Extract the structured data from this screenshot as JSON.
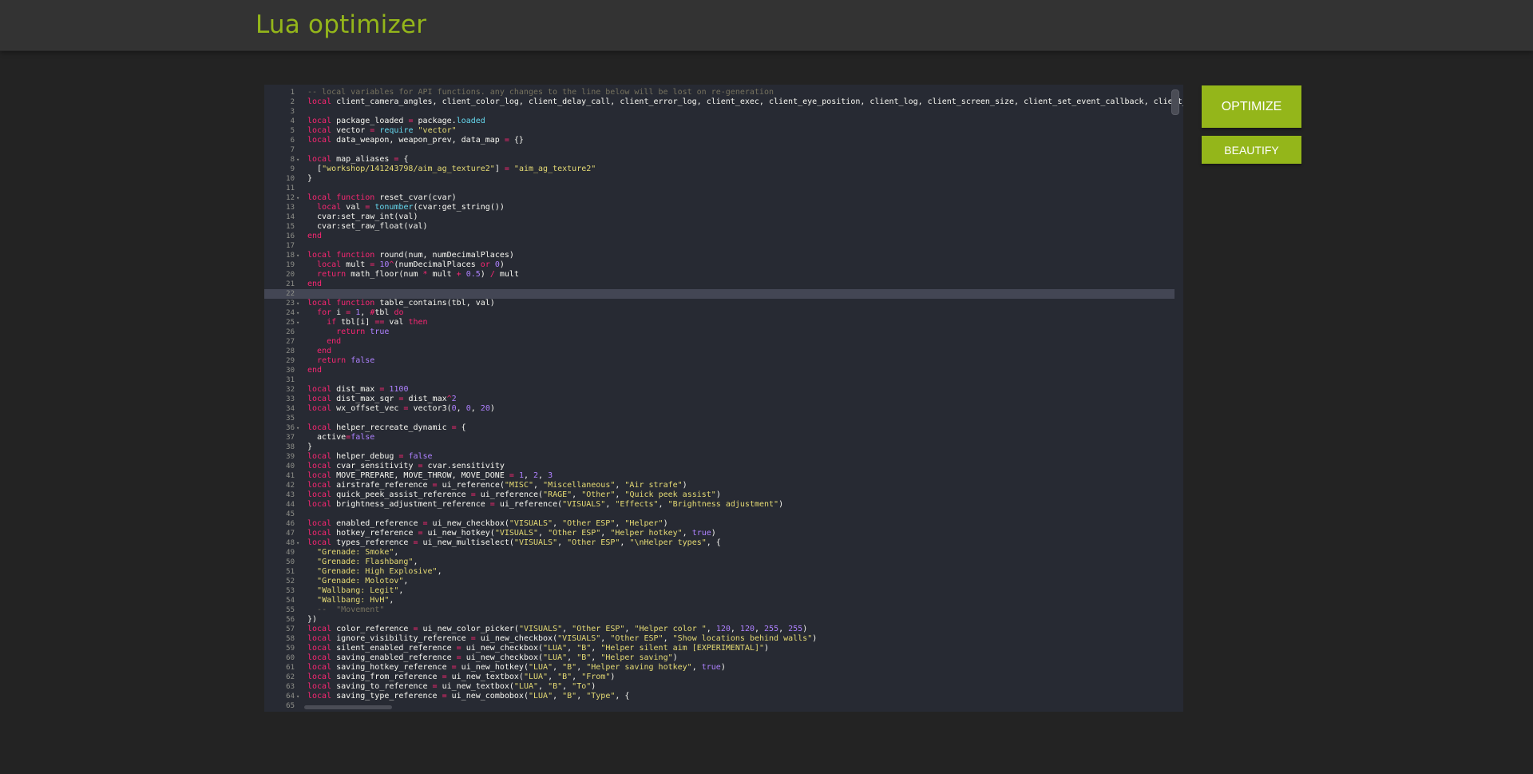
{
  "header": {
    "title": "Lua optimizer"
  },
  "buttons": {
    "optimize": "OPTIMIZE",
    "beautify": "BEAUTIFY"
  },
  "editor": {
    "active_line": 22,
    "fold_lines": [
      8,
      12,
      18,
      23,
      24,
      25,
      36,
      48,
      64
    ],
    "lines": [
      [
        [
          "c",
          "-- local variables for API functions. any changes to the line below will be lost on re-generation"
        ]
      ],
      [
        [
          "k",
          "local"
        ],
        [
          "t",
          " client_camera_angles, client_color_log, client_delay_call, client_error_log, client_exec, client_eye_position, client_log, client_screen_size, client_set_event_callback, client_userid_to_entindex"
        ]
      ],
      [],
      [
        [
          "k",
          "local"
        ],
        [
          "t",
          " package_loaded "
        ],
        [
          "o",
          "="
        ],
        [
          "t",
          " package."
        ],
        [
          "b",
          "loaded"
        ]
      ],
      [
        [
          "k",
          "local"
        ],
        [
          "t",
          " vector "
        ],
        [
          "o",
          "="
        ],
        [
          "t",
          " "
        ],
        [
          "b",
          "require"
        ],
        [
          "t",
          " "
        ],
        [
          "s",
          "\"vector\""
        ]
      ],
      [
        [
          "k",
          "local"
        ],
        [
          "t",
          " data_weapon, weapon_prev, data_map "
        ],
        [
          "o",
          "="
        ],
        [
          "t",
          " {}"
        ]
      ],
      [],
      [
        [
          "k",
          "local"
        ],
        [
          "t",
          " map_aliases "
        ],
        [
          "o",
          "="
        ],
        [
          "t",
          " {"
        ]
      ],
      [
        [
          "t",
          "  ["
        ],
        [
          "s",
          "\"workshop/141243798/aim_ag_texture2\""
        ],
        [
          "t",
          "] "
        ],
        [
          "o",
          "="
        ],
        [
          "t",
          " "
        ],
        [
          "s",
          "\"aim_ag_texture2\""
        ]
      ],
      [
        [
          "t",
          "}"
        ]
      ],
      [],
      [
        [
          "k",
          "local"
        ],
        [
          "t",
          " "
        ],
        [
          "k",
          "function"
        ],
        [
          "t",
          " reset_cvar(cvar)"
        ]
      ],
      [
        [
          "t",
          "  "
        ],
        [
          "k",
          "local"
        ],
        [
          "t",
          " val "
        ],
        [
          "o",
          "="
        ],
        [
          "t",
          " "
        ],
        [
          "b",
          "tonumber"
        ],
        [
          "t",
          "(cvar:get_string())"
        ]
      ],
      [
        [
          "t",
          "  cvar:set_raw_int(val)"
        ]
      ],
      [
        [
          "t",
          "  cvar:set_raw_float(val)"
        ]
      ],
      [
        [
          "k",
          "end"
        ]
      ],
      [],
      [
        [
          "k",
          "local"
        ],
        [
          "t",
          " "
        ],
        [
          "k",
          "function"
        ],
        [
          "t",
          " round(num, numDecimalPlaces)"
        ]
      ],
      [
        [
          "t",
          "  "
        ],
        [
          "k",
          "local"
        ],
        [
          "t",
          " mult "
        ],
        [
          "o",
          "="
        ],
        [
          "t",
          " "
        ],
        [
          "n",
          "10"
        ],
        [
          "o",
          "^"
        ],
        [
          "t",
          "(numDecimalPlaces "
        ],
        [
          "k",
          "or"
        ],
        [
          "t",
          " "
        ],
        [
          "n",
          "0"
        ],
        [
          "t",
          ")"
        ]
      ],
      [
        [
          "t",
          "  "
        ],
        [
          "k",
          "return"
        ],
        [
          "t",
          " math_floor(num "
        ],
        [
          "o",
          "*"
        ],
        [
          "t",
          " mult "
        ],
        [
          "o",
          "+"
        ],
        [
          "t",
          " "
        ],
        [
          "n",
          "0.5"
        ],
        [
          "t",
          ") "
        ],
        [
          "o",
          "/"
        ],
        [
          "t",
          " mult"
        ]
      ],
      [
        [
          "k",
          "end"
        ]
      ],
      [],
      [
        [
          "k",
          "local"
        ],
        [
          "t",
          " "
        ],
        [
          "k",
          "function"
        ],
        [
          "t",
          " table_contains(tbl, val)"
        ]
      ],
      [
        [
          "t",
          "  "
        ],
        [
          "k",
          "for"
        ],
        [
          "t",
          " i "
        ],
        [
          "o",
          "="
        ],
        [
          "t",
          " "
        ],
        [
          "n",
          "1"
        ],
        [
          "t",
          ", "
        ],
        [
          "o",
          "#"
        ],
        [
          "t",
          "tbl "
        ],
        [
          "k",
          "do"
        ]
      ],
      [
        [
          "t",
          "    "
        ],
        [
          "k",
          "if"
        ],
        [
          "t",
          " tbl[i] "
        ],
        [
          "o",
          "=="
        ],
        [
          "t",
          " val "
        ],
        [
          "k",
          "then"
        ]
      ],
      [
        [
          "t",
          "      "
        ],
        [
          "k",
          "return"
        ],
        [
          "t",
          " "
        ],
        [
          "n",
          "true"
        ]
      ],
      [
        [
          "t",
          "    "
        ],
        [
          "k",
          "end"
        ]
      ],
      [
        [
          "t",
          "  "
        ],
        [
          "k",
          "end"
        ]
      ],
      [
        [
          "t",
          "  "
        ],
        [
          "k",
          "return"
        ],
        [
          "t",
          " "
        ],
        [
          "n",
          "false"
        ]
      ],
      [
        [
          "k",
          "end"
        ]
      ],
      [],
      [
        [
          "k",
          "local"
        ],
        [
          "t",
          " dist_max "
        ],
        [
          "o",
          "="
        ],
        [
          "t",
          " "
        ],
        [
          "n",
          "1100"
        ]
      ],
      [
        [
          "k",
          "local"
        ],
        [
          "t",
          " dist_max_sqr "
        ],
        [
          "o",
          "="
        ],
        [
          "t",
          " dist_max"
        ],
        [
          "o",
          "^"
        ],
        [
          "n",
          "2"
        ]
      ],
      [
        [
          "k",
          "local"
        ],
        [
          "t",
          " wx_offset_vec "
        ],
        [
          "o",
          "="
        ],
        [
          "t",
          " vector3("
        ],
        [
          "n",
          "0"
        ],
        [
          "t",
          ", "
        ],
        [
          "n",
          "0"
        ],
        [
          "t",
          ", "
        ],
        [
          "n",
          "20"
        ],
        [
          "t",
          ")"
        ]
      ],
      [],
      [
        [
          "k",
          "local"
        ],
        [
          "t",
          " helper_recreate_dynamic "
        ],
        [
          "o",
          "="
        ],
        [
          "t",
          " {"
        ]
      ],
      [
        [
          "t",
          "  active"
        ],
        [
          "o",
          "="
        ],
        [
          "n",
          "false"
        ]
      ],
      [
        [
          "t",
          "}"
        ]
      ],
      [
        [
          "k",
          "local"
        ],
        [
          "t",
          " helper_debug "
        ],
        [
          "o",
          "="
        ],
        [
          "t",
          " "
        ],
        [
          "n",
          "false"
        ]
      ],
      [
        [
          "k",
          "local"
        ],
        [
          "t",
          " cvar_sensitivity "
        ],
        [
          "o",
          "="
        ],
        [
          "t",
          " cvar.sensitivity"
        ]
      ],
      [
        [
          "k",
          "local"
        ],
        [
          "t",
          " MOVE_PREPARE, MOVE_THROW, MOVE_DONE "
        ],
        [
          "o",
          "="
        ],
        [
          "t",
          " "
        ],
        [
          "n",
          "1"
        ],
        [
          "t",
          ", "
        ],
        [
          "n",
          "2"
        ],
        [
          "t",
          ", "
        ],
        [
          "n",
          "3"
        ]
      ],
      [
        [
          "k",
          "local"
        ],
        [
          "t",
          " airstrafe_reference "
        ],
        [
          "o",
          "="
        ],
        [
          "t",
          " ui_reference("
        ],
        [
          "s",
          "\"MISC\""
        ],
        [
          "t",
          ", "
        ],
        [
          "s",
          "\"Miscellaneous\""
        ],
        [
          "t",
          ", "
        ],
        [
          "s",
          "\"Air strafe\""
        ],
        [
          "t",
          ")"
        ]
      ],
      [
        [
          "k",
          "local"
        ],
        [
          "t",
          " quick_peek_assist_reference "
        ],
        [
          "o",
          "="
        ],
        [
          "t",
          " ui_reference("
        ],
        [
          "s",
          "\"RAGE\""
        ],
        [
          "t",
          ", "
        ],
        [
          "s",
          "\"Other\""
        ],
        [
          "t",
          ", "
        ],
        [
          "s",
          "\"Quick peek assist\""
        ],
        [
          "t",
          ")"
        ]
      ],
      [
        [
          "k",
          "local"
        ],
        [
          "t",
          " brightness_adjustment_reference "
        ],
        [
          "o",
          "="
        ],
        [
          "t",
          " ui_reference("
        ],
        [
          "s",
          "\"VISUALS\""
        ],
        [
          "t",
          ", "
        ],
        [
          "s",
          "\"Effects\""
        ],
        [
          "t",
          ", "
        ],
        [
          "s",
          "\"Brightness adjustment\""
        ],
        [
          "t",
          ")"
        ]
      ],
      [],
      [
        [
          "k",
          "local"
        ],
        [
          "t",
          " enabled_reference "
        ],
        [
          "o",
          "="
        ],
        [
          "t",
          " ui_new_checkbox("
        ],
        [
          "s",
          "\"VISUALS\""
        ],
        [
          "t",
          ", "
        ],
        [
          "s",
          "\"Other ESP\""
        ],
        [
          "t",
          ", "
        ],
        [
          "s",
          "\"Helper\""
        ],
        [
          "t",
          ")"
        ]
      ],
      [
        [
          "k",
          "local"
        ],
        [
          "t",
          " hotkey_reference "
        ],
        [
          "o",
          "="
        ],
        [
          "t",
          " ui_new_hotkey("
        ],
        [
          "s",
          "\"VISUALS\""
        ],
        [
          "t",
          ", "
        ],
        [
          "s",
          "\"Other ESP\""
        ],
        [
          "t",
          ", "
        ],
        [
          "s",
          "\"Helper hotkey\""
        ],
        [
          "t",
          ", "
        ],
        [
          "n",
          "true"
        ],
        [
          "t",
          ")"
        ]
      ],
      [
        [
          "k",
          "local"
        ],
        [
          "t",
          " types_reference "
        ],
        [
          "o",
          "="
        ],
        [
          "t",
          " ui_new_multiselect("
        ],
        [
          "s",
          "\"VISUALS\""
        ],
        [
          "t",
          ", "
        ],
        [
          "s",
          "\"Other ESP\""
        ],
        [
          "t",
          ", "
        ],
        [
          "s",
          "\"\\nHelper types\""
        ],
        [
          "t",
          ", {"
        ]
      ],
      [
        [
          "t",
          "  "
        ],
        [
          "s",
          "\"Grenade: Smoke\""
        ],
        [
          "t",
          ","
        ]
      ],
      [
        [
          "t",
          "  "
        ],
        [
          "s",
          "\"Grenade: Flashbang\""
        ],
        [
          "t",
          ","
        ]
      ],
      [
        [
          "t",
          "  "
        ],
        [
          "s",
          "\"Grenade: High Explosive\""
        ],
        [
          "t",
          ","
        ]
      ],
      [
        [
          "t",
          "  "
        ],
        [
          "s",
          "\"Grenade: Molotov\""
        ],
        [
          "t",
          ","
        ]
      ],
      [
        [
          "t",
          "  "
        ],
        [
          "s",
          "\"Wallbang: Legit\""
        ],
        [
          "t",
          ","
        ]
      ],
      [
        [
          "t",
          "  "
        ],
        [
          "s",
          "\"Wallbang: HvH\""
        ],
        [
          "t",
          ","
        ]
      ],
      [
        [
          "t",
          "  "
        ],
        [
          "c",
          "--  \"Movement\""
        ]
      ],
      [
        [
          "t",
          "})"
        ]
      ],
      [
        [
          "k",
          "local"
        ],
        [
          "t",
          " color_reference "
        ],
        [
          "o",
          "="
        ],
        [
          "t",
          " ui_new_color_picker("
        ],
        [
          "s",
          "\"VISUALS\""
        ],
        [
          "t",
          ", "
        ],
        [
          "s",
          "\"Other ESP\""
        ],
        [
          "t",
          ", "
        ],
        [
          "s",
          "\"Helper color \""
        ],
        [
          "t",
          ", "
        ],
        [
          "n",
          "120"
        ],
        [
          "t",
          ", "
        ],
        [
          "n",
          "120"
        ],
        [
          "t",
          ", "
        ],
        [
          "n",
          "255"
        ],
        [
          "t",
          ", "
        ],
        [
          "n",
          "255"
        ],
        [
          "t",
          ")"
        ]
      ],
      [
        [
          "k",
          "local"
        ],
        [
          "t",
          " ignore_visibility_reference "
        ],
        [
          "o",
          "="
        ],
        [
          "t",
          " ui_new_checkbox("
        ],
        [
          "s",
          "\"VISUALS\""
        ],
        [
          "t",
          ", "
        ],
        [
          "s",
          "\"Other ESP\""
        ],
        [
          "t",
          ", "
        ],
        [
          "s",
          "\"Show locations behind walls\""
        ],
        [
          "t",
          ")"
        ]
      ],
      [
        [
          "k",
          "local"
        ],
        [
          "t",
          " silent_enabled_reference "
        ],
        [
          "o",
          "="
        ],
        [
          "t",
          " ui_new_checkbox("
        ],
        [
          "s",
          "\"LUA\""
        ],
        [
          "t",
          ", "
        ],
        [
          "s",
          "\"B\""
        ],
        [
          "t",
          ", "
        ],
        [
          "s",
          "\"Helper silent aim [EXPERIMENTAL]\""
        ],
        [
          "t",
          ")"
        ]
      ],
      [
        [
          "k",
          "local"
        ],
        [
          "t",
          " saving_enabled_reference "
        ],
        [
          "o",
          "="
        ],
        [
          "t",
          " ui_new_checkbox("
        ],
        [
          "s",
          "\"LUA\""
        ],
        [
          "t",
          ", "
        ],
        [
          "s",
          "\"B\""
        ],
        [
          "t",
          ", "
        ],
        [
          "s",
          "\"Helper saving\""
        ],
        [
          "t",
          ")"
        ]
      ],
      [
        [
          "k",
          "local"
        ],
        [
          "t",
          " saving_hotkey_reference "
        ],
        [
          "o",
          "="
        ],
        [
          "t",
          " ui_new_hotkey("
        ],
        [
          "s",
          "\"LUA\""
        ],
        [
          "t",
          ", "
        ],
        [
          "s",
          "\"B\""
        ],
        [
          "t",
          ", "
        ],
        [
          "s",
          "\"Helper saving hotkey\""
        ],
        [
          "t",
          ", "
        ],
        [
          "n",
          "true"
        ],
        [
          "t",
          ")"
        ]
      ],
      [
        [
          "k",
          "local"
        ],
        [
          "t",
          " saving_from_reference "
        ],
        [
          "o",
          "="
        ],
        [
          "t",
          " ui_new_textbox("
        ],
        [
          "s",
          "\"LUA\""
        ],
        [
          "t",
          ", "
        ],
        [
          "s",
          "\"B\""
        ],
        [
          "t",
          ", "
        ],
        [
          "s",
          "\"From\""
        ],
        [
          "t",
          ")"
        ]
      ],
      [
        [
          "k",
          "local"
        ],
        [
          "t",
          " saving_to_reference "
        ],
        [
          "o",
          "="
        ],
        [
          "t",
          " ui_new_textbox("
        ],
        [
          "s",
          "\"LUA\""
        ],
        [
          "t",
          ", "
        ],
        [
          "s",
          "\"B\""
        ],
        [
          "t",
          ", "
        ],
        [
          "s",
          "\"To\""
        ],
        [
          "t",
          ")"
        ]
      ],
      [
        [
          "k",
          "local"
        ],
        [
          "t",
          " saving_type_reference "
        ],
        [
          "o",
          "="
        ],
        [
          "t",
          " ui_new_combobox("
        ],
        [
          "s",
          "\"LUA\""
        ],
        [
          "t",
          ", "
        ],
        [
          "s",
          "\"B\""
        ],
        [
          "t",
          ", "
        ],
        [
          "s",
          "\"Type\""
        ],
        [
          "t",
          ", {"
        ]
      ],
      []
    ]
  }
}
